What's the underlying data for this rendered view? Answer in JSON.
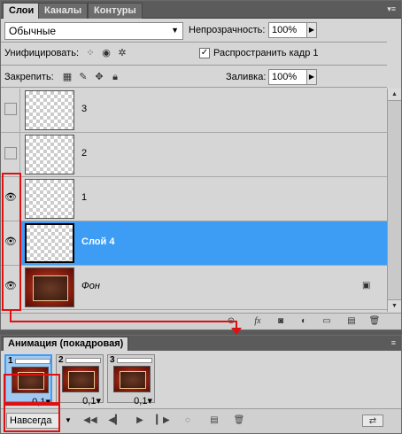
{
  "layers_panel": {
    "tabs": [
      "Слои",
      "Каналы",
      "Контуры"
    ],
    "blend_mode": "Обычные",
    "opacity_label": "Непрозрачность:",
    "opacity_value": "100%",
    "unify_label": "Унифицировать:",
    "propagate_label": "Распространить кадр 1",
    "propagate_checked": true,
    "lock_label": "Закрепить:",
    "fill_label": "Заливка:",
    "fill_value": "100%",
    "layers": [
      {
        "name": "3",
        "visible": false,
        "selected": false,
        "thumb": "transparent"
      },
      {
        "name": "2",
        "visible": false,
        "selected": false,
        "thumb": "transparent"
      },
      {
        "name": "1",
        "visible": true,
        "selected": false,
        "thumb": "transparent"
      },
      {
        "name": "Слой 4",
        "visible": true,
        "selected": true,
        "thumb": "transparent"
      },
      {
        "name": "Фон",
        "visible": true,
        "selected": false,
        "thumb": "image",
        "locked": true
      }
    ],
    "toolbar_icons": [
      "link-icon",
      "fx-icon",
      "mask-icon",
      "adjustment-icon",
      "folder-icon",
      "new-layer-icon",
      "trash-icon"
    ]
  },
  "animation_panel": {
    "title": "Анимация (покадровая)",
    "frames": [
      {
        "number": "1",
        "delay": "0,1",
        "selected": true
      },
      {
        "number": "2",
        "delay": "0,1",
        "selected": false
      },
      {
        "number": "3",
        "delay": "0,1",
        "selected": false
      }
    ],
    "loop": "Навсегда",
    "controls": [
      "first-frame-icon",
      "prev-frame-icon",
      "play-icon",
      "next-frame-icon",
      "tween-icon",
      "duplicate-frame-icon",
      "delete-frame-icon"
    ]
  },
  "colors": {
    "selection": "#3d9df5",
    "highlight": "#e01010"
  }
}
